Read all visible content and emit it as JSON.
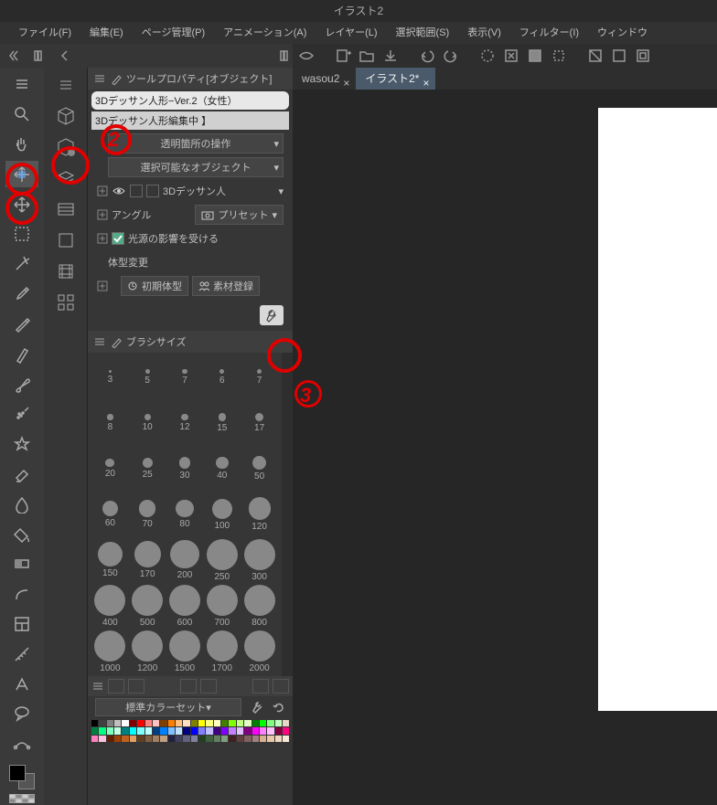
{
  "title": "イラスト2",
  "menu": [
    "ファイル(F)",
    "編集(E)",
    "ページ管理(P)",
    "アニメーション(A)",
    "レイヤー(L)",
    "選択範囲(S)",
    "表示(V)",
    "フィルター(I)",
    "ウィンドウ"
  ],
  "tabs": [
    {
      "label": "wasou2",
      "active": false
    },
    {
      "label": "イラスト2*",
      "active": true
    }
  ],
  "tool_property": {
    "panel_title": "ツールプロパティ[オブジェクト]",
    "object_name": "3Dデッサン人形−Ver.2（女性）",
    "editing_label": "3Dデッサン人形編集中 】",
    "dropdown_transparent": "透明箇所の操作",
    "dropdown_selectable": "選択可能なオブジェクト",
    "layer_name": "3Dデッサン人",
    "angle_label": "アングル",
    "preset_label": "プリセット",
    "light_label": "光源の影響を受ける",
    "body_change_label": "体型変更",
    "btn_initial": "初期体型",
    "btn_register": "素材登録"
  },
  "brush_panel": {
    "title": "ブラシサイズ",
    "sizes": [
      3,
      5,
      7,
      6,
      7,
      8,
      10,
      12,
      15,
      17,
      20,
      25,
      30,
      40,
      50,
      60,
      70,
      80,
      100,
      120,
      150,
      170,
      200,
      250,
      300,
      400,
      500,
      600,
      700,
      800,
      1000,
      1200,
      1500,
      1700,
      2000
    ]
  },
  "color_set": {
    "label": "標準カラーセット",
    "colors": [
      "#000000",
      "#404040",
      "#808080",
      "#c0c0c0",
      "#ffffff",
      "#800000",
      "#ff0000",
      "#ff8080",
      "#ffc0c0",
      "#804000",
      "#ff8000",
      "#ffc080",
      "#ffe0c0",
      "#808000",
      "#ffff00",
      "#ffff80",
      "#ffffc0",
      "#408000",
      "#80ff00",
      "#c0ff80",
      "#e0ffc0",
      "#008000",
      "#00ff00",
      "#80ff80",
      "#c0ffc0",
      "#e8d8c8",
      "#008040",
      "#00ff80",
      "#80ffc0",
      "#c0ffe0",
      "#008080",
      "#00ffff",
      "#80ffff",
      "#c0ffff",
      "#004080",
      "#0080ff",
      "#80c0ff",
      "#c0e0ff",
      "#000080",
      "#0000ff",
      "#8080ff",
      "#c0c0ff",
      "#400080",
      "#8000ff",
      "#c080ff",
      "#e0c0ff",
      "#800080",
      "#ff00ff",
      "#ff80ff",
      "#ffc0ff",
      "#800040",
      "#ff0080",
      "#ff80c0",
      "#ffc0e0",
      "#602000",
      "#a04000",
      "#c06020",
      "#e0a060",
      "#604020",
      "#806040",
      "#a08060",
      "#c0a080",
      "#202040",
      "#404060",
      "#606080",
      "#8080a0",
      "#204020",
      "#406040",
      "#608060",
      "#80a080",
      "#402020",
      "#604040",
      "#806060",
      "#a08080",
      "#d8b090",
      "#e8c8a8",
      "#f0d8c0",
      "#f8e8d8"
    ]
  },
  "annotations": {
    "n2": "2",
    "n3": "3"
  }
}
